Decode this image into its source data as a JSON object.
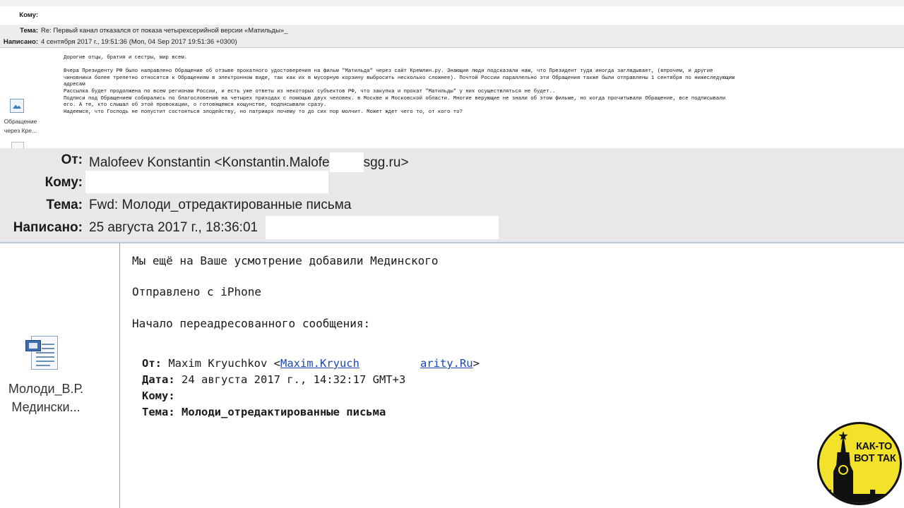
{
  "top_email": {
    "to_label": "Кому:",
    "subject_label": "Тема:",
    "subject_value": "Re: Первый канал отказался от показа четырехсерийной версии «Матильды»_",
    "date_label": "Написано:",
    "date_value": "4 сентября 2017 г., 19:51:36  (Mon, 04 Sep 2017 19:51:36 +0300)",
    "body": "Дорогие отцы, братия и сестры, мир всем.\n\nВчера Президенту РФ было направлено Обращение об отзыве прокатного удостоверения на фильм \"Матильда\" через сайт Кремлин.ру. Знающие люди подсказали нам, что Президент туда иногда заглядывает, (впрочем, и другие\nчиновники более трепетно относятся к Обращениям в электронном виде, так как их в мусорную корзину выбросить несколько сложнее). Почтой России параллельно эти Обращения также были отправлены 1 сентября по нижеследующим\nадресам\nРассылка будет продолжена по всем регионам России, и есть уже ответы из некоторых субъектов РФ, что закупка и прокат \"Матильды\" у них осуществляться не будет..\nПодписи под Обращением собирались по благословению на четырех приходах с помощью двух человек. в Москве и Московской области. Многие верующие не знали об этом фильме, но когда прочитывали Обращение, все подписывали\nего. А те, кто слышал об этой провокации, о готовящемся кощунстве, подписывали сразу.\nНадеемся, что Господь не попустит состояться злодейству, но патриарх почему то до сих пор молчит. Может ждет чего то, от кого то?",
    "attachment_label_1": "Обращение",
    "attachment_label_2": "через Кре..."
  },
  "main_email": {
    "from_label": "От:",
    "from_value_a": "Malofeev Konstantin <Konstantin.Malofe",
    "from_value_b": "sgg.ru>",
    "to_label": "Кому:",
    "subject_label": "Тема:",
    "subject_value": "Fwd: Молоди_отредактированные письма",
    "date_label": "Написано:",
    "date_value": "25 августа 2017 г., 18:36:01",
    "body_line_1": "Мы ещё на Ваше усмотрение добавили Мединского",
    "body_line_2": "Отправлено с iPhone",
    "body_line_3": "Начало переадресованного сообщения:",
    "attachment_label_1": "Молоди_В.Р.",
    "attachment_label_2": "Медински...",
    "forwarded": {
      "from_label": "От:",
      "from_name": " Maxim Kryuchkov <",
      "from_link_a": "Maxim.Kryuch",
      "from_link_b": "arity.Ru",
      "from_tail": ">",
      "date_label": "Дата:",
      "date_value": " 24 августа 2017 г., 14:32:17 GMT+3",
      "to_label": "Кому:",
      "subject_label": "Тема:",
      "subject_value": " Молоди_отредактированные письма"
    }
  },
  "watermark": {
    "line1": "КАК-ТО",
    "line2": "ВОТ ТАК",
    "color": "#f3e22a"
  }
}
